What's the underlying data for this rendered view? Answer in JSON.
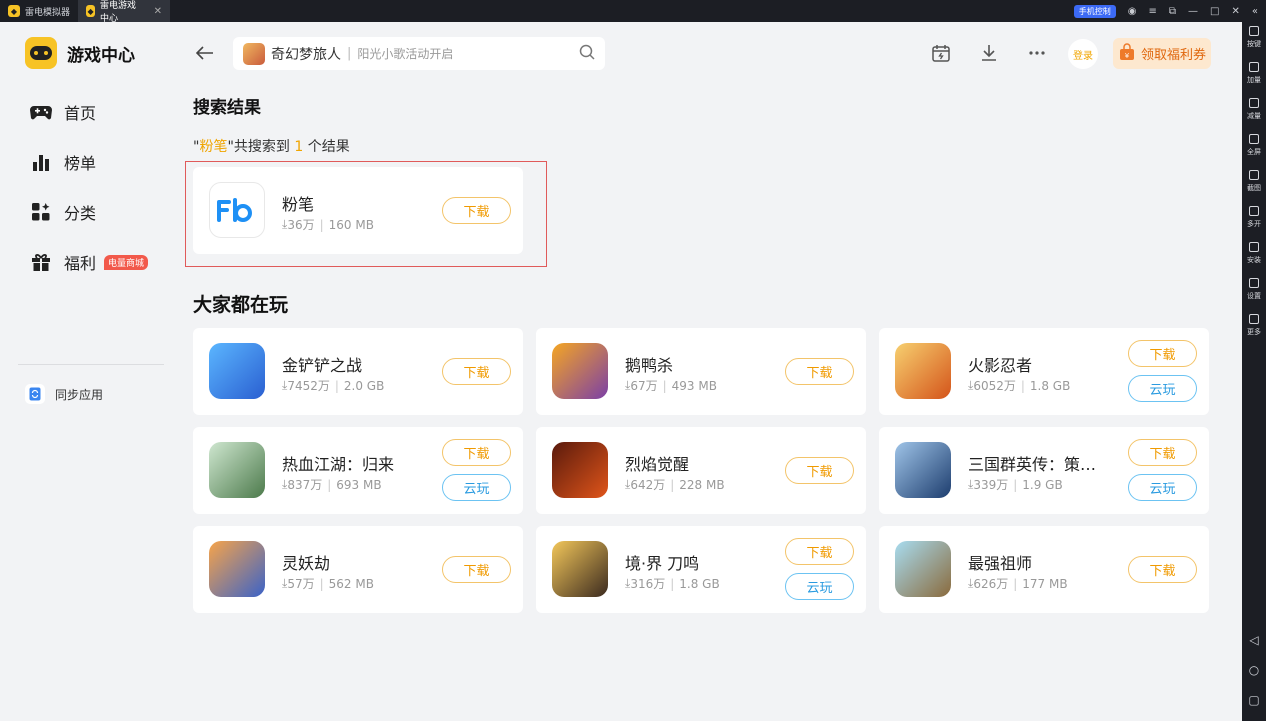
{
  "titlebar": {
    "tabs": [
      {
        "label": "雷电模拟器"
      },
      {
        "label": "雷电游戏中心"
      }
    ],
    "phone_control": "手机控制"
  },
  "right_toolbar": {
    "items": [
      {
        "label": "按键"
      },
      {
        "label": "加量"
      },
      {
        "label": "减量"
      },
      {
        "label": "全屏"
      },
      {
        "label": "截图"
      },
      {
        "label": "多开"
      },
      {
        "label": "安装"
      },
      {
        "label": "设置"
      },
      {
        "label": "更多"
      }
    ]
  },
  "sidebar": {
    "app_title": "游戏中心",
    "items": [
      {
        "label": "首页"
      },
      {
        "label": "榜单"
      },
      {
        "label": "分类"
      },
      {
        "label": "福利",
        "badge": "电量商城"
      }
    ],
    "sync_label": "同步应用"
  },
  "header": {
    "search_game": "奇幻梦旅人",
    "search_tip": "阳光小歌活动开启",
    "login_label": "登录",
    "coupon_label": "领取福利券"
  },
  "search_results": {
    "title": "搜索结果",
    "query": "粉笔",
    "prefix": "\"",
    "middle": "\"共搜索到 ",
    "count": "1",
    "suffix": " 个结果",
    "item": {
      "name": "粉笔",
      "downloads": "36万",
      "size": "160 MB",
      "download_label": "下载"
    }
  },
  "popular": {
    "title": "大家都在玩",
    "download_label": "下载",
    "cloud_label": "云玩",
    "games": [
      {
        "name": "金铲铲之战",
        "downloads": "7452万",
        "size": "2.0 GB",
        "cloud": false
      },
      {
        "name": "鹅鸭杀",
        "downloads": "67万",
        "size": "493 MB",
        "cloud": false
      },
      {
        "name": "火影忍者",
        "downloads": "6052万",
        "size": "1.8 GB",
        "cloud": true
      },
      {
        "name": "热血江湖：归来",
        "downloads": "837万",
        "size": "693 MB",
        "cloud": true
      },
      {
        "name": "烈焰觉醒",
        "downloads": "642万",
        "size": "228 MB",
        "cloud": false
      },
      {
        "name": "三国群英传：策定九州",
        "downloads": "339万",
        "size": "1.9 GB",
        "cloud": true
      },
      {
        "name": "灵妖劫",
        "downloads": "57万",
        "size": "562 MB",
        "cloud": false
      },
      {
        "name": "境·界 刀鸣",
        "downloads": "316万",
        "size": "1.8 GB",
        "cloud": true
      },
      {
        "name": "最强祖师",
        "downloads": "626万",
        "size": "177 MB",
        "cloud": false
      }
    ]
  }
}
